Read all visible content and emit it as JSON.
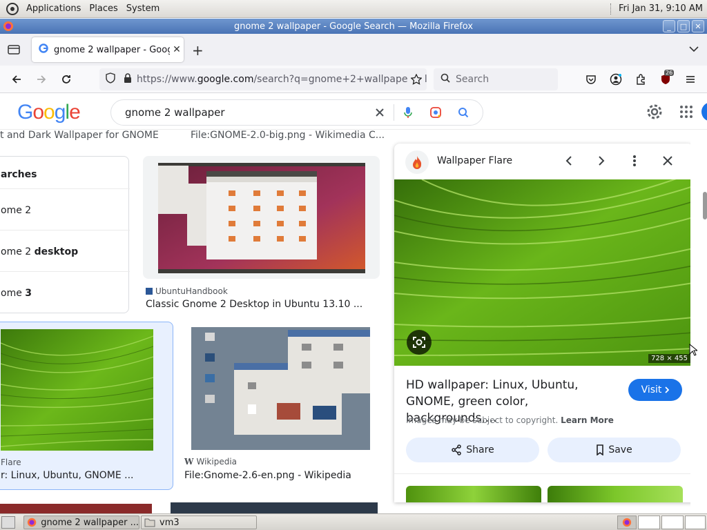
{
  "gnome_panel": {
    "menus": [
      "Applications",
      "Places",
      "System"
    ],
    "clock": "Fri Jan 31,  9:10 AM"
  },
  "window": {
    "title": "gnome 2 wallpaper - Google Search — Mozilla Firefox"
  },
  "tabs": [
    {
      "label": "gnome 2 wallpaper - Google"
    }
  ],
  "navbar": {
    "url_prefix": "https://www.",
    "url_domain": "google.com",
    "url_rest": "/search?q=gnome+2+wallpaper&cli",
    "search_placeholder": "Search",
    "badge": "26"
  },
  "google": {
    "logo_letters": [
      "G",
      "o",
      "o",
      "g",
      "l",
      "e"
    ],
    "logo_colors": [
      "#4285f4",
      "#ea4335",
      "#fbbc05",
      "#4285f4",
      "#34a853",
      "#ea4335"
    ],
    "query": "gnome 2 wallpaper"
  },
  "results": {
    "top_left_caption": "t and Dark Wallpaper for GNOME",
    "top_mid_caption": "File:GNOME-2.0-big.png - Wikimedia C...",
    "related_heading": "arches",
    "related_items": [
      {
        "pre": "ome 2",
        "bold": ""
      },
      {
        "pre": "ome 2 ",
        "bold": "desktop"
      },
      {
        "pre": "ome ",
        "bold": "3"
      }
    ],
    "card2_source": "UbuntuHandbook",
    "card2_caption": "Classic Gnome 2 Desktop in Ubuntu 13.10 ...",
    "card3_source": "Flare",
    "card3_caption": "r: Linux, Ubuntu, GNOME ...",
    "card4_source": "Wikipedia",
    "card4_caption": "File:Gnome-2.6-en.png - Wikipedia"
  },
  "panel": {
    "site_name": "Wallpaper Flare",
    "dimensions": "728 × 455",
    "title": "HD wallpaper: Linux, Ubuntu, GNOME, green color, backgrounds,…",
    "visit_label": "Visit",
    "copyright": "Images may be subject to copyright.",
    "learn_more": "Learn More",
    "share_label": "Share",
    "save_label": "Save"
  },
  "taskbar": {
    "tasks": [
      "gnome 2 wallpaper ...",
      "vm3"
    ]
  },
  "colors": {
    "accent": "#1a73e8",
    "leaf_green": "#5ea814",
    "titlebar": "#5a82c2"
  }
}
